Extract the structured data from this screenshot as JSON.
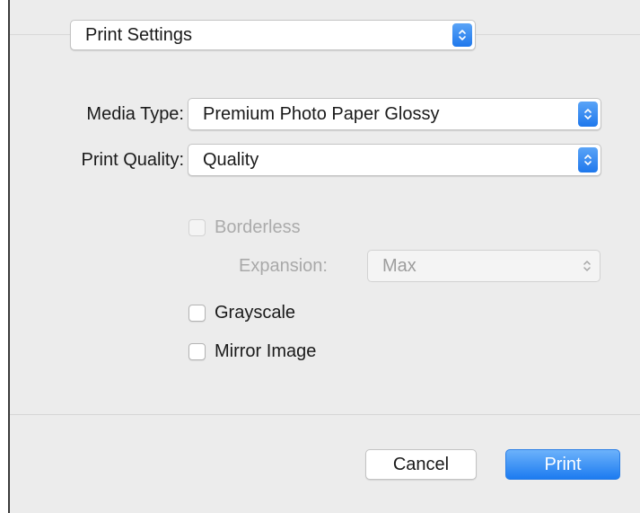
{
  "dialog": {
    "panel_selector": "Print Settings"
  },
  "form": {
    "media_type": {
      "label": "Media Type:",
      "value": "Premium Photo Paper Glossy"
    },
    "print_quality": {
      "label": "Print Quality:",
      "value": "Quality"
    }
  },
  "options": {
    "borderless": {
      "label": "Borderless",
      "checked": false,
      "enabled": false
    },
    "expansion": {
      "label": "Expansion:",
      "value": "Max",
      "enabled": false
    },
    "grayscale": {
      "label": "Grayscale",
      "checked": false,
      "enabled": true
    },
    "mirror_image": {
      "label": "Mirror Image",
      "checked": false,
      "enabled": true
    }
  },
  "buttons": {
    "cancel": "Cancel",
    "print": "Print"
  },
  "colors": {
    "accent": "#1f78ec",
    "panel_background": "#ececec"
  },
  "icons": {
    "popup_arrows": "up-down-chevron-icon"
  }
}
